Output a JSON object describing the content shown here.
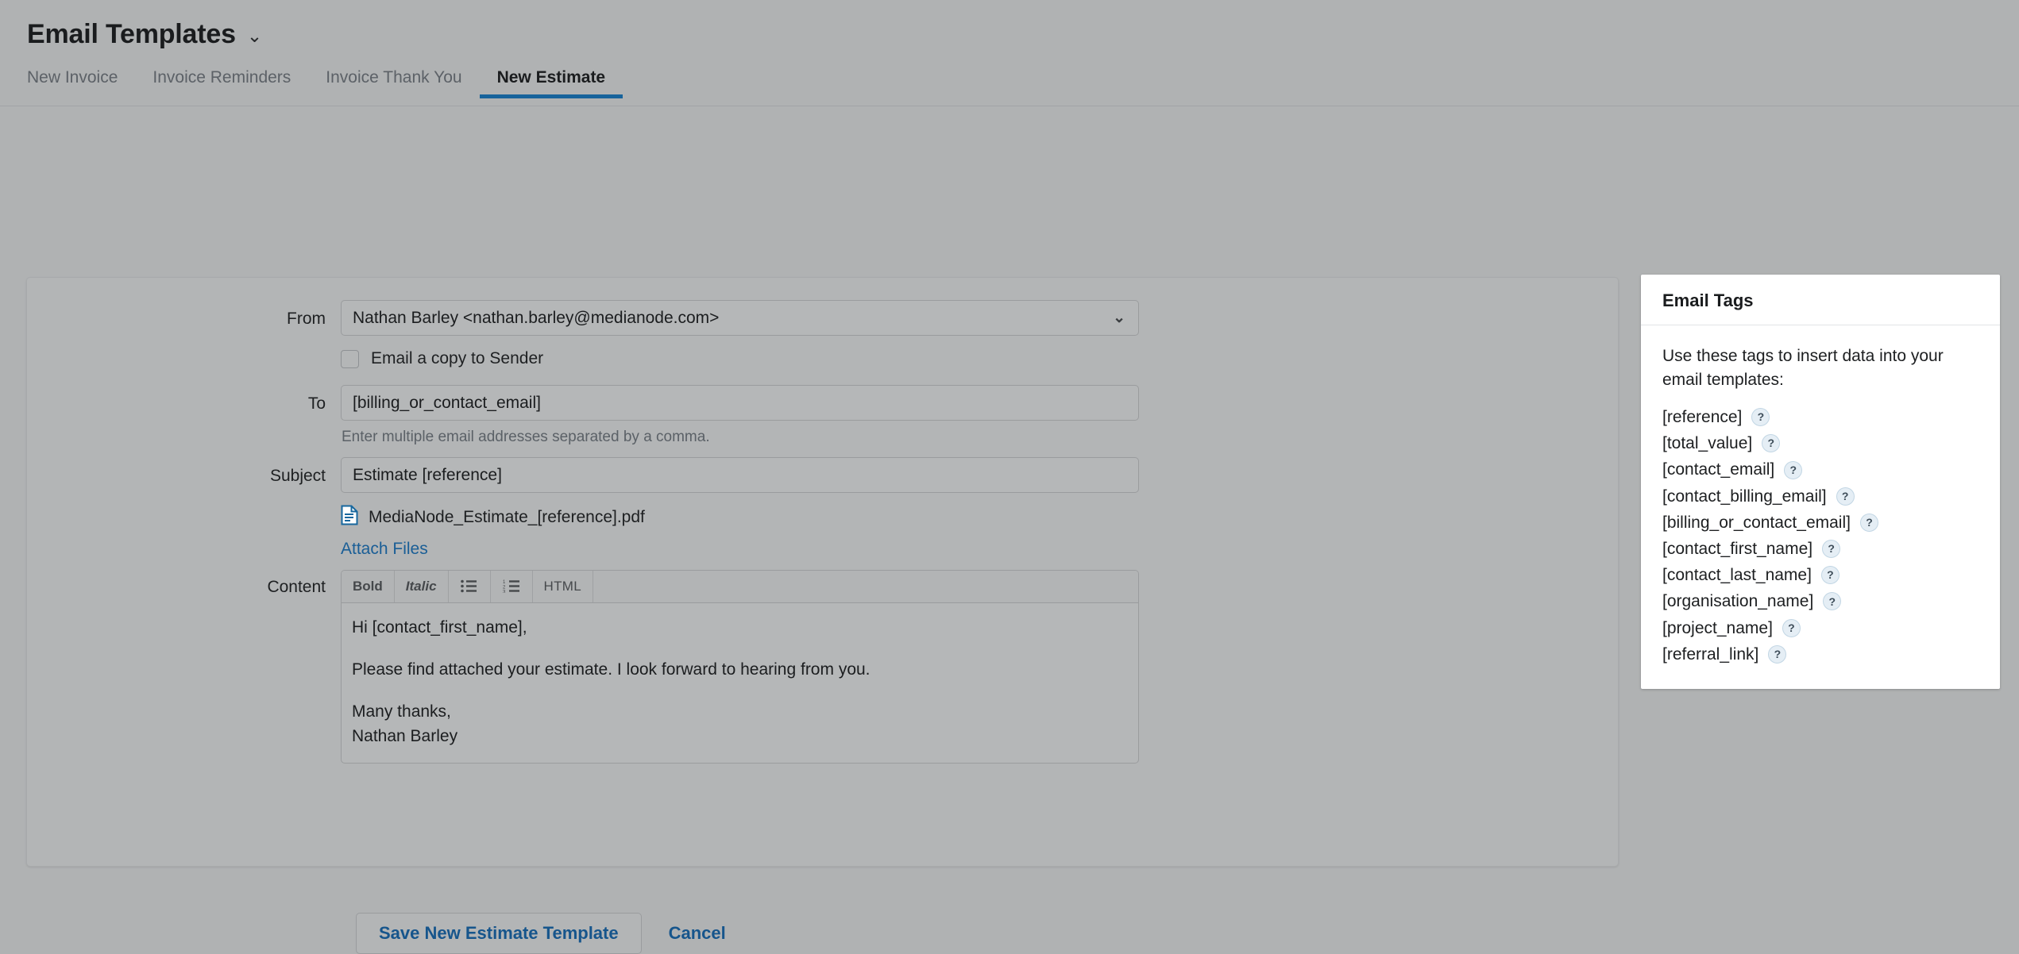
{
  "header": {
    "title": "Email Templates",
    "caret_icon": "chevron-down-icon"
  },
  "tabs": [
    {
      "label": "New Invoice",
      "active": false
    },
    {
      "label": "Invoice Reminders",
      "active": false
    },
    {
      "label": "Invoice Thank You",
      "active": false
    },
    {
      "label": "New Estimate",
      "active": true
    }
  ],
  "form": {
    "from": {
      "label": "From",
      "value": "Nathan Barley <nathan.barley@medianode.com>"
    },
    "copy_sender": {
      "label": "Email a copy to Sender",
      "checked": false
    },
    "to": {
      "label": "To",
      "value": "[billing_or_contact_email]",
      "hint": "Enter multiple email addresses separated by a comma."
    },
    "subject": {
      "label": "Subject",
      "value": "Estimate [reference]"
    },
    "attachment": {
      "icon": "document-icon",
      "filename": "MediaNode_Estimate_[reference].pdf",
      "attach_link": "Attach Files"
    },
    "content": {
      "label": "Content",
      "toolbar": [
        {
          "label": "Bold",
          "style": "bold",
          "name": "bold-button"
        },
        {
          "label": "Italic",
          "style": "italic",
          "name": "italic-button"
        },
        {
          "label": "☰",
          "style": "icon",
          "name": "bullet-list-button"
        },
        {
          "label": "☰",
          "style": "icon-numbered",
          "name": "numbered-list-button"
        },
        {
          "label": "HTML",
          "style": "plain",
          "name": "html-button"
        }
      ],
      "paragraphs": [
        "Hi [contact_first_name],",
        "Please find attached your estimate. I look forward to hearing from you.",
        "Many thanks,\nNathan Barley"
      ],
      "body_line_1": "Hi [contact_first_name],",
      "body_line_2": "Please find attached your estimate. I look forward to hearing from you.",
      "body_line_3": "Many thanks,",
      "body_line_4": "Nathan Barley"
    }
  },
  "email_tags_panel": {
    "title": "Email Tags",
    "intro": "Use these tags to insert data into your email templates:",
    "help_glyph": "?",
    "tags": [
      {
        "label": "[reference]"
      },
      {
        "label": "[total_value]"
      },
      {
        "label": "[contact_email]"
      },
      {
        "label": "[contact_billing_email]"
      },
      {
        "label": "[billing_or_contact_email]"
      },
      {
        "label": "[contact_first_name]"
      },
      {
        "label": "[contact_last_name]"
      },
      {
        "label": "[organisation_name]"
      },
      {
        "label": "[project_name]"
      },
      {
        "label": "[referral_link]"
      }
    ]
  },
  "footer": {
    "save_label": "Save New Estimate Template",
    "cancel_label": "Cancel"
  },
  "colors": {
    "accent": "#17639b",
    "link": "#16558c",
    "page_bg": "#b0b2b3",
    "panel_bg": "#ffffff"
  }
}
